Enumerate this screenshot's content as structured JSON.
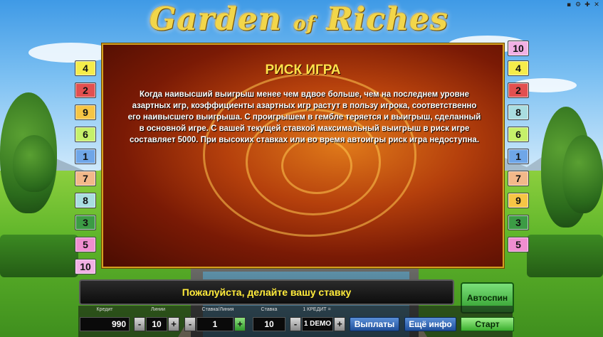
{
  "game": {
    "logo": {
      "word1": "Garden",
      "word2": "of",
      "word3": "Riches"
    }
  },
  "window_controls": [
    "minimize-icon",
    "settings-icon",
    "fullscreen-icon",
    "close-icon"
  ],
  "paytable": {
    "title": "РИСК ИГРА",
    "text": "Когда наивысший выигрыш менее чем вдвое больше, чем на последнем уровне азартных игр, коэффициенты азартных игр растут в пользу игрока, соответственно его наивысшего выигрыша. С проигрышем в гембле теряется и выигрыш, сделанный в основной игре. С вашей текущей ставкой максимальный выигрыш в риск игре составляет 5000. При высоких ставках или во время автоигры риск игра недоступна."
  },
  "lines_left": [
    {
      "label": "4",
      "color": "#f5ec4a"
    },
    {
      "label": "2",
      "color": "#e25050"
    },
    {
      "label": "9",
      "color": "#f6c545"
    },
    {
      "label": "6",
      "color": "#c6f06a"
    },
    {
      "label": "1",
      "color": "#6fa6e8"
    },
    {
      "label": "7",
      "color": "#f2b88a"
    },
    {
      "label": "8",
      "color": "#a9dde0"
    },
    {
      "label": "3",
      "color": "#3c9b45"
    },
    {
      "label": "5",
      "color": "#ef8ed0"
    },
    {
      "label": "10",
      "color": "#f2b0e4"
    }
  ],
  "lines_right": [
    {
      "label": "10",
      "color": "#f2b0e4"
    },
    {
      "label": "4",
      "color": "#f5ec4a"
    },
    {
      "label": "2",
      "color": "#e25050"
    },
    {
      "label": "8",
      "color": "#a9dde0"
    },
    {
      "label": "6",
      "color": "#c6f06a"
    },
    {
      "label": "1",
      "color": "#6fa6e8"
    },
    {
      "label": "7",
      "color": "#f2b88a"
    },
    {
      "label": "9",
      "color": "#f6c545"
    },
    {
      "label": "3",
      "color": "#3c9b45"
    },
    {
      "label": "5",
      "color": "#ef8ed0"
    }
  ],
  "message": "Пожалуйста, делайте вашу ставку",
  "buttons": {
    "autospin": "Автоспин",
    "payouts": "Выплаты",
    "more_info": "Ещё инфо",
    "start": "Старт",
    "minus": "-",
    "plus": "+"
  },
  "controls": {
    "credit": {
      "label": "Кредит",
      "value": "990"
    },
    "lines": {
      "label": "Линии",
      "value": "10"
    },
    "bet_per_line": {
      "label": "Ставка/Линия",
      "value": "1"
    },
    "bet": {
      "label": "Ставка",
      "value": "10"
    },
    "credit_rate": {
      "label": "1 КРЕДИТ =",
      "value": "1 DEMO"
    }
  }
}
